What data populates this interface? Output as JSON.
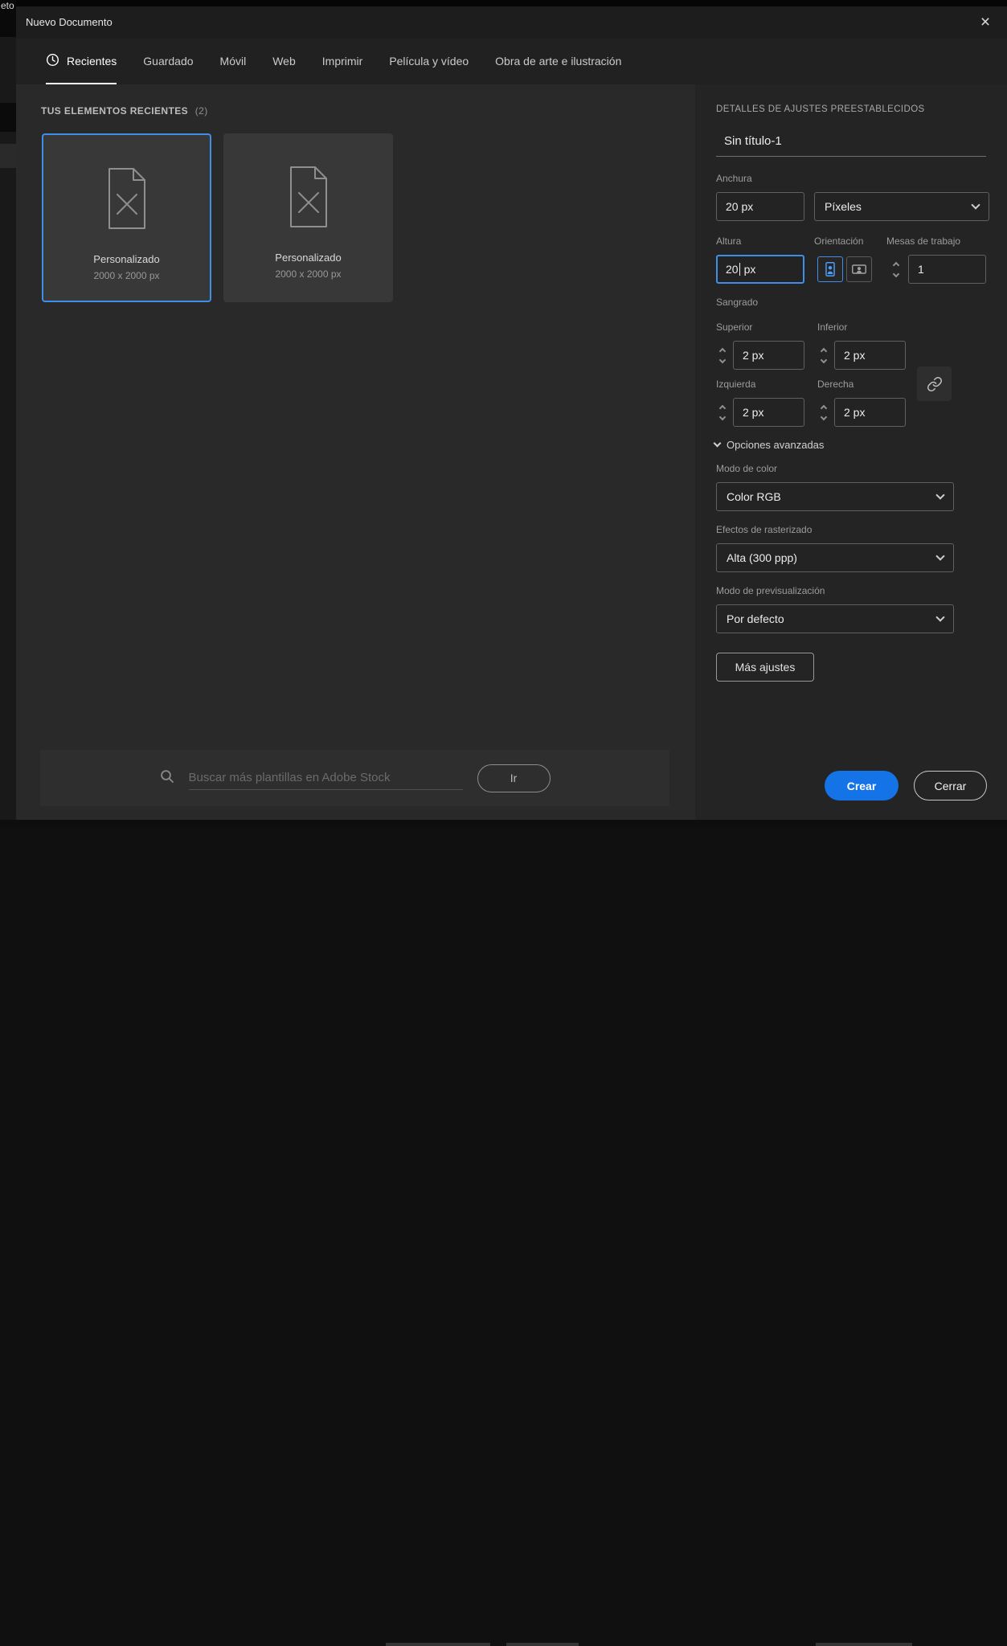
{
  "chrome": {
    "top_left_fragment": "eto"
  },
  "colors": {
    "accent_blue": "#1473e6",
    "focus_border": "#3f8ee8",
    "dialog_bg": "#282828",
    "panel_bg": "#242424"
  },
  "dialog": {
    "title": "Nuevo Documento",
    "close_glyph": "×"
  },
  "tabs": [
    {
      "label": "Recientes",
      "active": true
    },
    {
      "label": "Guardado",
      "active": false
    },
    {
      "label": "Móvil",
      "active": false
    },
    {
      "label": "Web",
      "active": false
    },
    {
      "label": "Imprimir",
      "active": false
    },
    {
      "label": "Película y vídeo",
      "active": false
    },
    {
      "label": "Obra de arte e ilustración",
      "active": false
    }
  ],
  "recent": {
    "heading": "TUS ELEMENTOS RECIENTES",
    "count": "(2)",
    "items": [
      {
        "name": "Personalizado",
        "size": "2000 x 2000 px",
        "selected": true
      },
      {
        "name": "Personalizado",
        "size": "2000 x 2000 px",
        "selected": false
      }
    ]
  },
  "search": {
    "placeholder": "Buscar más plantillas en Adobe Stock",
    "button_label": "Ir"
  },
  "panel": {
    "heading": "DETALLES DE AJUSTES PREESTABLECIDOS",
    "document_name": "Sin título-1",
    "width_label": "Anchura",
    "width_value": "20 px",
    "units_value": "Píxeles",
    "height_label": "Altura",
    "height_value": "20",
    "height_unit": "px",
    "orientation_label": "Orientación",
    "orientation_selected": "portrait",
    "artboards_label": "Mesas de trabajo",
    "artboards_value": "1",
    "bleed_label": "Sangrado",
    "bleed_top_label": "Superior",
    "bleed_top_value": "2 px",
    "bleed_bottom_label": "Inferior",
    "bleed_bottom_value": "2 px",
    "bleed_left_label": "Izquierda",
    "bleed_left_value": "2 px",
    "bleed_right_label": "Derecha",
    "bleed_right_value": "2 px",
    "advanced_label": "Opciones avanzadas",
    "color_mode_label": "Modo de color",
    "color_mode_value": "Color RGB",
    "raster_label": "Efectos de rasterizado",
    "raster_value": "Alta (300 ppp)",
    "preview_label": "Modo de previsualización",
    "preview_value": "Por defecto",
    "more_settings_label": "Más ajustes",
    "create_label": "Crear",
    "close_label": "Cerrar"
  }
}
